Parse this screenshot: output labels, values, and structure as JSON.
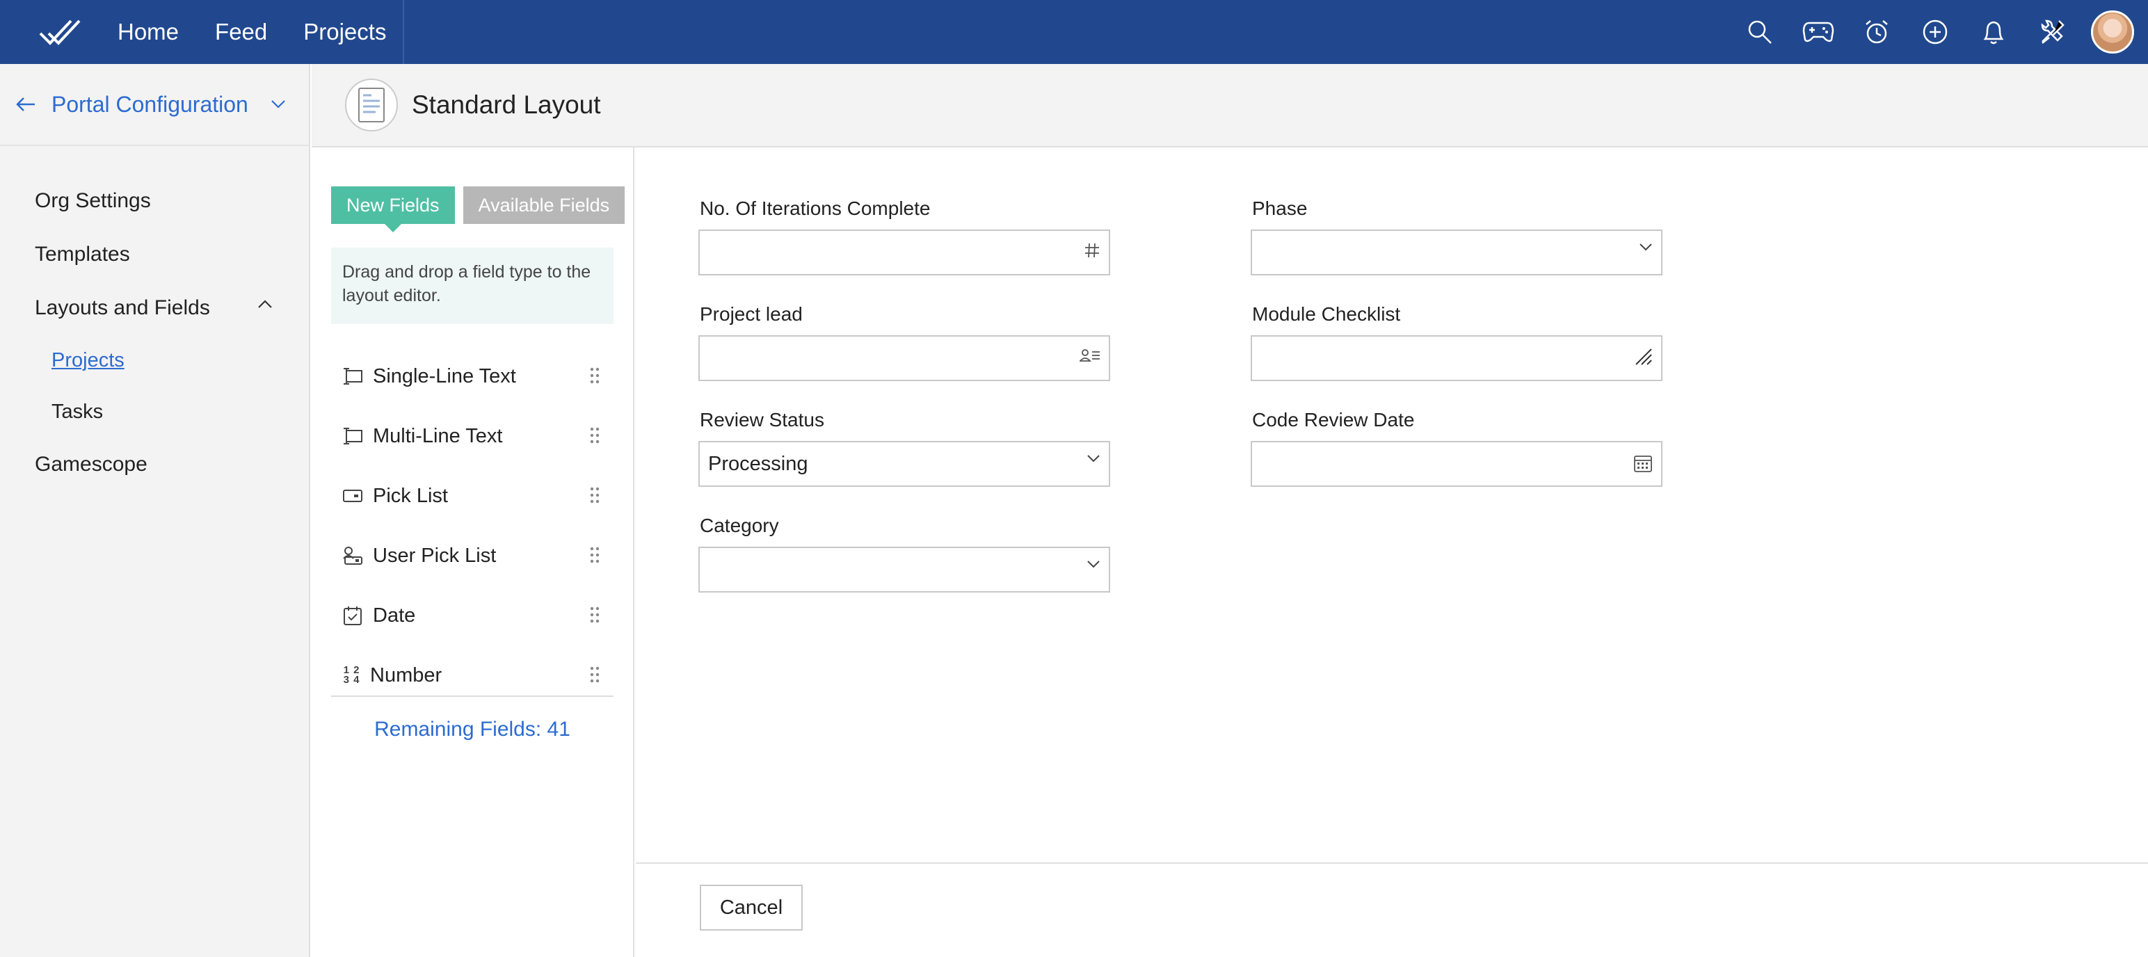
{
  "topbar": {
    "nav": [
      "Home",
      "Feed",
      "Projects"
    ],
    "icons": [
      "search-icon",
      "gamepad-icon",
      "timer-icon",
      "add-icon",
      "bell-icon",
      "tools-icon"
    ],
    "accent_color": "#21488e"
  },
  "sidebar": {
    "title": "Portal Configuration",
    "items": [
      {
        "label": "Org Settings"
      },
      {
        "label": "Templates"
      },
      {
        "label": "Layouts and Fields"
      },
      {
        "label": "Projects"
      },
      {
        "label": "Tasks"
      },
      {
        "label": "Gamescope"
      }
    ]
  },
  "layout": {
    "title": "Standard Layout"
  },
  "fields_panel": {
    "tabs": {
      "new": "New Fields",
      "available": "Available Fields"
    },
    "hint": "Drag and drop a field type to the layout editor.",
    "types": [
      {
        "label": "Single-Line Text",
        "icon": "single-line-text-icon"
      },
      {
        "label": "Multi-Line Text",
        "icon": "multi-line-text-icon"
      },
      {
        "label": "Pick List",
        "icon": "pick-list-icon"
      },
      {
        "label": "User Pick List",
        "icon": "user-pick-list-icon"
      },
      {
        "label": "Date",
        "icon": "date-icon"
      },
      {
        "label": "Number",
        "icon": "number-icon",
        "glyph": "1 2 3 4"
      }
    ],
    "remaining": "Remaining Fields: 41"
  },
  "form": {
    "fields": [
      {
        "label": "No. Of Iterations Complete",
        "value": "",
        "icon": "hash-icon"
      },
      {
        "label": "Phase",
        "value": "",
        "icon": "chevron-down-icon"
      },
      {
        "label": "Project lead",
        "value": "",
        "icon": "user-lookup-icon"
      },
      {
        "label": "Module Checklist",
        "value": "",
        "icon": "resize-icon"
      },
      {
        "label": "Review Status",
        "value": "Processing",
        "icon": "chevron-down-icon"
      },
      {
        "label": "Code Review Date",
        "value": "",
        "icon": "calendar-icon"
      },
      {
        "label": "Category",
        "value": "",
        "icon": "chevron-down-icon"
      }
    ]
  },
  "footer": {
    "cancel": "Cancel"
  }
}
